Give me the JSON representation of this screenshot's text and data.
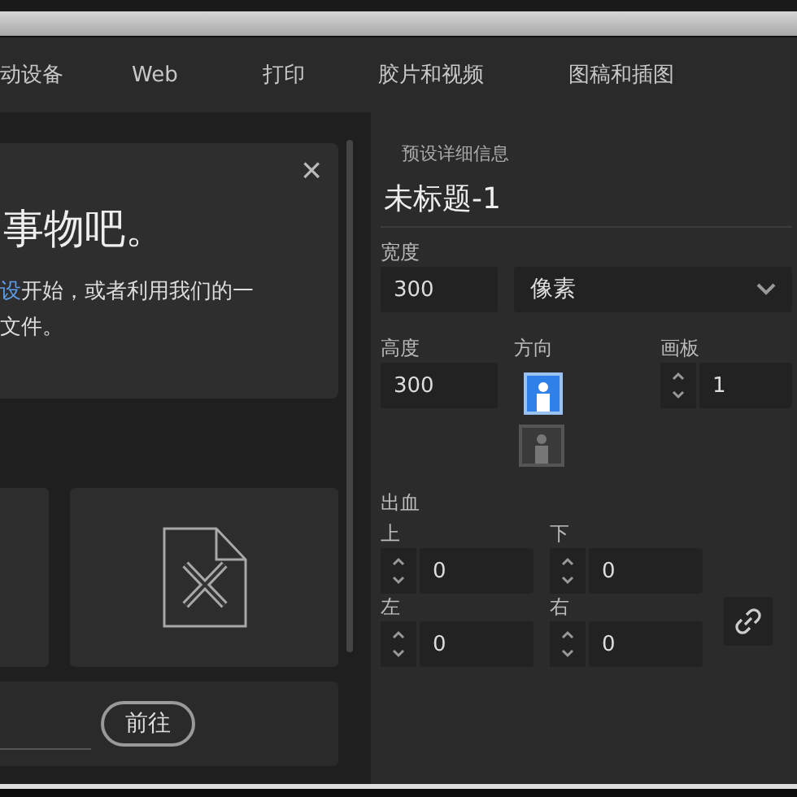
{
  "tabs": [
    {
      "label": "动设备"
    },
    {
      "label": "Web"
    },
    {
      "label": "打印"
    },
    {
      "label": "胶片和视频"
    },
    {
      "label": "图稿和插图"
    }
  ],
  "welcome": {
    "close": "×",
    "heading": "事物吧。",
    "link": "设",
    "text": "开始，或者利用我们的一文件。"
  },
  "templates": [
    {
      "kind": "blank"
    },
    {
      "kind": "document"
    }
  ],
  "go_button": "前往",
  "details": {
    "section": "预设详细信息",
    "name": "未标题-1",
    "width": {
      "label": "宽度",
      "value": "300"
    },
    "units": {
      "value": "像素"
    },
    "height": {
      "label": "高度",
      "value": "300"
    },
    "orientation": {
      "label": "方向",
      "options": [
        {
          "kind": "portrait",
          "selected": true
        },
        {
          "kind": "landscape",
          "selected": false
        }
      ]
    },
    "artboards": {
      "label": "画板",
      "value": "1"
    },
    "bleed": {
      "label": "出血",
      "fields": [
        {
          "label": "上",
          "value": "0"
        },
        {
          "label": "下",
          "value": "0"
        },
        {
          "label": "左",
          "value": "0"
        },
        {
          "label": "右",
          "value": "0"
        }
      ]
    }
  }
}
